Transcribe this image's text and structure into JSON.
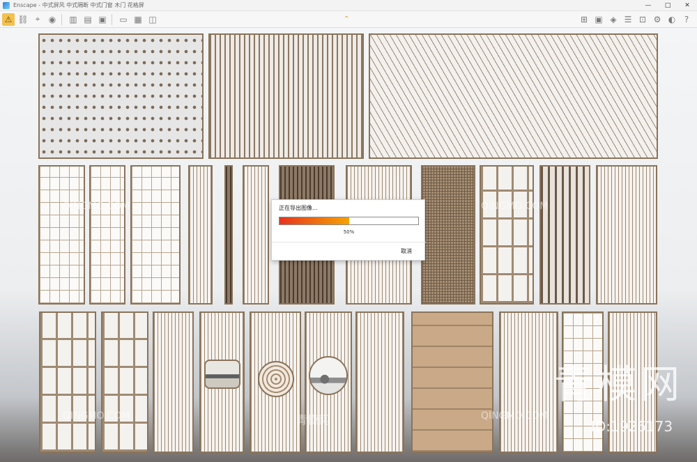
{
  "window": {
    "app_name": "Enscape",
    "title": "Enscape - 中式屏风 中式隔断 中式门窗 木门 花格屏",
    "controls": {
      "minimize": "—",
      "maximize": "□",
      "close": "✕"
    }
  },
  "toolbar": {
    "left_icons": [
      "warning-icon",
      "link-icon",
      "map-pin-icon",
      "camera-icon",
      "building-icon",
      "film-icon",
      "image-icon",
      "folder-icon",
      "export-icon",
      "settings-icon",
      "view-icon"
    ],
    "right_icons": [
      "grid-icon",
      "panel-icon",
      "cube-icon",
      "layers-icon",
      "asset-icon",
      "settings-icon",
      "user-icon",
      "help-icon"
    ],
    "help_label": "?",
    "collapse_arrow": "⌃"
  },
  "watermarks": {
    "brand_cn": "青模网",
    "site": "QINGMO.COM",
    "id_label": "ID:1926173"
  },
  "dialog": {
    "title": "正在导出图像...",
    "progress_percent": 50,
    "progress_label": "50%",
    "cancel_label": "取消",
    "accent": "#f6a200"
  }
}
